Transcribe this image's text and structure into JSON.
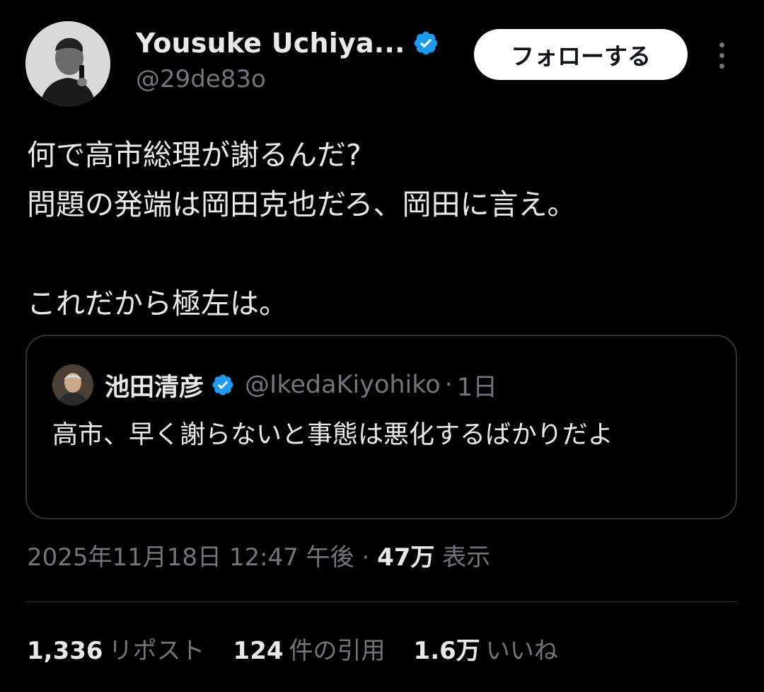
{
  "author": {
    "display_name": "Yousuke Uchiya...",
    "handle": "@29de83o",
    "verified_icon": "verified-badge-icon"
  },
  "follow_button": {
    "label": "フォローする"
  },
  "more_button": {
    "icon": "more-vertical-icon"
  },
  "tweet": {
    "line1": "何で高市総理が謝るんだ?",
    "line2": "問題の発端は岡田克也だろ、岡田に言え。",
    "line3": "これだから極左は。"
  },
  "quoted": {
    "name": "池田清彦",
    "handle": "@IkedaKiyohiko",
    "separator": "·",
    "time": "1日",
    "text": "高市、早く謝らないと事態は悪化するばかりだよ"
  },
  "meta": {
    "timestamp": "2025年11月18日 12:47 午後",
    "separator": "·",
    "views_count": "47万",
    "views_label": "表示"
  },
  "stats": {
    "reposts_count": "1,336",
    "reposts_label": "リポスト",
    "quotes_count": "124",
    "quotes_label": "件の引用",
    "likes_count": "1.6万",
    "likes_label": "いいね"
  },
  "colors": {
    "background": "#000000",
    "text": "#e7e9ea",
    "secondary": "#71767b",
    "border": "#2f3336",
    "verified": "#1d9bf0"
  }
}
